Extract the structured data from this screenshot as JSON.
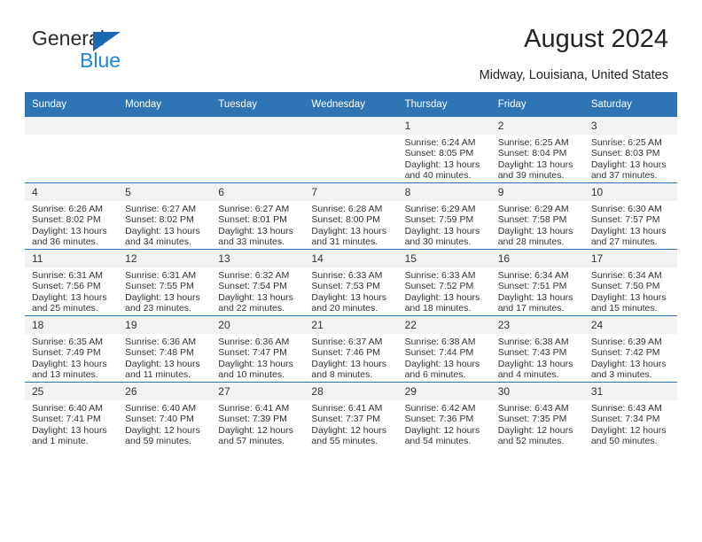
{
  "brand": {
    "name_part1": "General",
    "name_part2": "Blue",
    "accent_color": "#1c68b3",
    "blue_text_color": "#1f87d8"
  },
  "header": {
    "title": "August 2024",
    "subtitle": "Midway, Louisiana, United States",
    "header_bg_color": "#2e75b6"
  },
  "weekdays": [
    "Sunday",
    "Monday",
    "Tuesday",
    "Wednesday",
    "Thursday",
    "Friday",
    "Saturday"
  ],
  "weeks": [
    [
      {
        "day": "",
        "blank": true,
        "sunrise": "",
        "sunset": "",
        "daylight1": "",
        "daylight2": ""
      },
      {
        "day": "",
        "blank": true,
        "sunrise": "",
        "sunset": "",
        "daylight1": "",
        "daylight2": ""
      },
      {
        "day": "",
        "blank": true,
        "sunrise": "",
        "sunset": "",
        "daylight1": "",
        "daylight2": ""
      },
      {
        "day": "",
        "blank": true,
        "sunrise": "",
        "sunset": "",
        "daylight1": "",
        "daylight2": ""
      },
      {
        "day": "1",
        "blank": false,
        "sunrise": "Sunrise: 6:24 AM",
        "sunset": "Sunset: 8:05 PM",
        "daylight1": "Daylight: 13 hours",
        "daylight2": "and 40 minutes."
      },
      {
        "day": "2",
        "blank": false,
        "sunrise": "Sunrise: 6:25 AM",
        "sunset": "Sunset: 8:04 PM",
        "daylight1": "Daylight: 13 hours",
        "daylight2": "and 39 minutes."
      },
      {
        "day": "3",
        "blank": false,
        "sunrise": "Sunrise: 6:25 AM",
        "sunset": "Sunset: 8:03 PM",
        "daylight1": "Daylight: 13 hours",
        "daylight2": "and 37 minutes."
      }
    ],
    [
      {
        "day": "4",
        "blank": false,
        "sunrise": "Sunrise: 6:26 AM",
        "sunset": "Sunset: 8:02 PM",
        "daylight1": "Daylight: 13 hours",
        "daylight2": "and 36 minutes."
      },
      {
        "day": "5",
        "blank": false,
        "sunrise": "Sunrise: 6:27 AM",
        "sunset": "Sunset: 8:02 PM",
        "daylight1": "Daylight: 13 hours",
        "daylight2": "and 34 minutes."
      },
      {
        "day": "6",
        "blank": false,
        "sunrise": "Sunrise: 6:27 AM",
        "sunset": "Sunset: 8:01 PM",
        "daylight1": "Daylight: 13 hours",
        "daylight2": "and 33 minutes."
      },
      {
        "day": "7",
        "blank": false,
        "sunrise": "Sunrise: 6:28 AM",
        "sunset": "Sunset: 8:00 PM",
        "daylight1": "Daylight: 13 hours",
        "daylight2": "and 31 minutes."
      },
      {
        "day": "8",
        "blank": false,
        "sunrise": "Sunrise: 6:29 AM",
        "sunset": "Sunset: 7:59 PM",
        "daylight1": "Daylight: 13 hours",
        "daylight2": "and 30 minutes."
      },
      {
        "day": "9",
        "blank": false,
        "sunrise": "Sunrise: 6:29 AM",
        "sunset": "Sunset: 7:58 PM",
        "daylight1": "Daylight: 13 hours",
        "daylight2": "and 28 minutes."
      },
      {
        "day": "10",
        "blank": false,
        "sunrise": "Sunrise: 6:30 AM",
        "sunset": "Sunset: 7:57 PM",
        "daylight1": "Daylight: 13 hours",
        "daylight2": "and 27 minutes."
      }
    ],
    [
      {
        "day": "11",
        "blank": false,
        "sunrise": "Sunrise: 6:31 AM",
        "sunset": "Sunset: 7:56 PM",
        "daylight1": "Daylight: 13 hours",
        "daylight2": "and 25 minutes."
      },
      {
        "day": "12",
        "blank": false,
        "sunrise": "Sunrise: 6:31 AM",
        "sunset": "Sunset: 7:55 PM",
        "daylight1": "Daylight: 13 hours",
        "daylight2": "and 23 minutes."
      },
      {
        "day": "13",
        "blank": false,
        "sunrise": "Sunrise: 6:32 AM",
        "sunset": "Sunset: 7:54 PM",
        "daylight1": "Daylight: 13 hours",
        "daylight2": "and 22 minutes."
      },
      {
        "day": "14",
        "blank": false,
        "sunrise": "Sunrise: 6:33 AM",
        "sunset": "Sunset: 7:53 PM",
        "daylight1": "Daylight: 13 hours",
        "daylight2": "and 20 minutes."
      },
      {
        "day": "15",
        "blank": false,
        "sunrise": "Sunrise: 6:33 AM",
        "sunset": "Sunset: 7:52 PM",
        "daylight1": "Daylight: 13 hours",
        "daylight2": "and 18 minutes."
      },
      {
        "day": "16",
        "blank": false,
        "sunrise": "Sunrise: 6:34 AM",
        "sunset": "Sunset: 7:51 PM",
        "daylight1": "Daylight: 13 hours",
        "daylight2": "and 17 minutes."
      },
      {
        "day": "17",
        "blank": false,
        "sunrise": "Sunrise: 6:34 AM",
        "sunset": "Sunset: 7:50 PM",
        "daylight1": "Daylight: 13 hours",
        "daylight2": "and 15 minutes."
      }
    ],
    [
      {
        "day": "18",
        "blank": false,
        "sunrise": "Sunrise: 6:35 AM",
        "sunset": "Sunset: 7:49 PM",
        "daylight1": "Daylight: 13 hours",
        "daylight2": "and 13 minutes."
      },
      {
        "day": "19",
        "blank": false,
        "sunrise": "Sunrise: 6:36 AM",
        "sunset": "Sunset: 7:48 PM",
        "daylight1": "Daylight: 13 hours",
        "daylight2": "and 11 minutes."
      },
      {
        "day": "20",
        "blank": false,
        "sunrise": "Sunrise: 6:36 AM",
        "sunset": "Sunset: 7:47 PM",
        "daylight1": "Daylight: 13 hours",
        "daylight2": "and 10 minutes."
      },
      {
        "day": "21",
        "blank": false,
        "sunrise": "Sunrise: 6:37 AM",
        "sunset": "Sunset: 7:46 PM",
        "daylight1": "Daylight: 13 hours",
        "daylight2": "and 8 minutes."
      },
      {
        "day": "22",
        "blank": false,
        "sunrise": "Sunrise: 6:38 AM",
        "sunset": "Sunset: 7:44 PM",
        "daylight1": "Daylight: 13 hours",
        "daylight2": "and 6 minutes."
      },
      {
        "day": "23",
        "blank": false,
        "sunrise": "Sunrise: 6:38 AM",
        "sunset": "Sunset: 7:43 PM",
        "daylight1": "Daylight: 13 hours",
        "daylight2": "and 4 minutes."
      },
      {
        "day": "24",
        "blank": false,
        "sunrise": "Sunrise: 6:39 AM",
        "sunset": "Sunset: 7:42 PM",
        "daylight1": "Daylight: 13 hours",
        "daylight2": "and 3 minutes."
      }
    ],
    [
      {
        "day": "25",
        "blank": false,
        "sunrise": "Sunrise: 6:40 AM",
        "sunset": "Sunset: 7:41 PM",
        "daylight1": "Daylight: 13 hours",
        "daylight2": "and 1 minute."
      },
      {
        "day": "26",
        "blank": false,
        "sunrise": "Sunrise: 6:40 AM",
        "sunset": "Sunset: 7:40 PM",
        "daylight1": "Daylight: 12 hours",
        "daylight2": "and 59 minutes."
      },
      {
        "day": "27",
        "blank": false,
        "sunrise": "Sunrise: 6:41 AM",
        "sunset": "Sunset: 7:39 PM",
        "daylight1": "Daylight: 12 hours",
        "daylight2": "and 57 minutes."
      },
      {
        "day": "28",
        "blank": false,
        "sunrise": "Sunrise: 6:41 AM",
        "sunset": "Sunset: 7:37 PM",
        "daylight1": "Daylight: 12 hours",
        "daylight2": "and 55 minutes."
      },
      {
        "day": "29",
        "blank": false,
        "sunrise": "Sunrise: 6:42 AM",
        "sunset": "Sunset: 7:36 PM",
        "daylight1": "Daylight: 12 hours",
        "daylight2": "and 54 minutes."
      },
      {
        "day": "30",
        "blank": false,
        "sunrise": "Sunrise: 6:43 AM",
        "sunset": "Sunset: 7:35 PM",
        "daylight1": "Daylight: 12 hours",
        "daylight2": "and 52 minutes."
      },
      {
        "day": "31",
        "blank": false,
        "sunrise": "Sunrise: 6:43 AM",
        "sunset": "Sunset: 7:34 PM",
        "daylight1": "Daylight: 12 hours",
        "daylight2": "and 50 minutes."
      }
    ]
  ]
}
